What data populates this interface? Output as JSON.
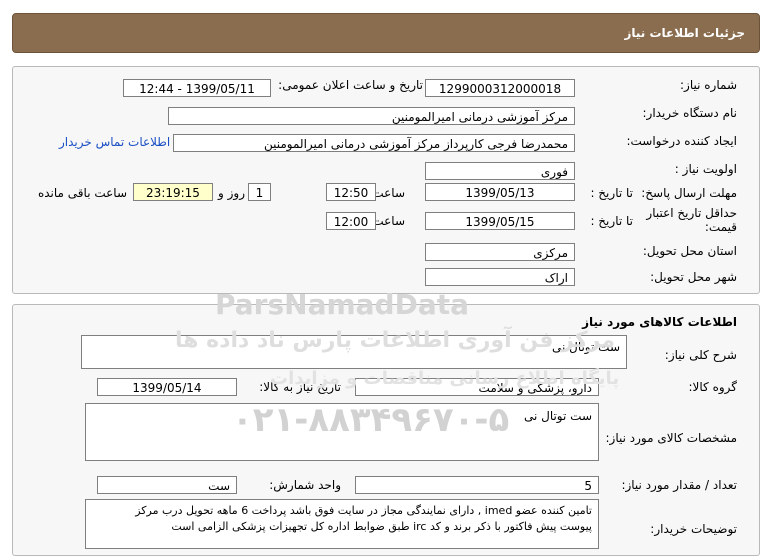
{
  "header": {
    "title": "جزئیات اطلاعات نیاز"
  },
  "info": {
    "need_number_label": "شماره نیاز:",
    "need_number": "1299000312000018",
    "announce_label": "تاریخ و ساعت اعلان عمومی:",
    "announce_value": "1399/05/11 - 12:44",
    "buyer_label": "نام دستگاه خریدار:",
    "buyer_value": "مرکز آموزشی درمانی امیرالمومنین",
    "creator_label": "ایجاد کننده درخواست:",
    "creator_value": "محمدرضا فرجی کارپرداز مرکز آموزشی درمانی امیرالمومنین",
    "contact_link": "اطلاعات تماس خریدار",
    "priority_label": "اولویت نیاز :",
    "priority_value": "فوری",
    "deadline_label": "مهلت ارسال پاسخ:",
    "to_date_label": "تا تاریخ :",
    "deadline_date": "1399/05/13",
    "time_label": "ساعت",
    "deadline_time": "12:50",
    "days_value": "1",
    "days_label": "روز و",
    "remaining_time": "23:19:15",
    "remaining_label": "ساعت باقی مانده",
    "validity_label_1": "حداقل تاریخ اعتبار",
    "validity_label_2": "قیمت:",
    "validity_date": "1399/05/15",
    "validity_time": "12:00",
    "province_label": "استان محل تحویل:",
    "province_value": "مرکزی",
    "city_label": "شهر محل تحویل:",
    "city_value": "اراک"
  },
  "goods": {
    "section_title": "اطلاعات کالاهای مورد نیاز",
    "desc_label": "شرح کلی نیاز:",
    "desc_value": "ست توتال نی",
    "group_label": "گروه کالا:",
    "group_value": "دارو، پزشکی و سلامت",
    "need_date_label": "تاریخ نیاز به کالا:",
    "need_date_value": "1399/05/14",
    "spec_label": "مشخصات کالای مورد نیاز:",
    "spec_value": "ست توتال نی",
    "qty_label": "تعداد / مقدار مورد نیاز:",
    "qty_value": "5",
    "unit_label": "واحد شمارش:",
    "unit_value": "ست",
    "notes_label": "توضیحات خریدار:",
    "notes_line1": "تامین کننده عضو imed , دارای نمایندگی مجاز در سایت فوق باشد  پرداخت 6 ماهه تحویل درب مرکز",
    "notes_line2": "پیوست پیش فاکتور با ذکر برند و کد irc  طبق ضوابط اداره کل تجهیزات پزشکی الزامی است"
  },
  "watermark": {
    "brand": "ParsNamadData",
    "line1": "مرکز فن آوری اطلاعات پارس ناد داده ها",
    "line2": "پایگاه اطلاع رسانی مناقصات و مزایدات",
    "phone": "۰۲۱-۸۸۳۴۹۶۷۰-۵"
  }
}
